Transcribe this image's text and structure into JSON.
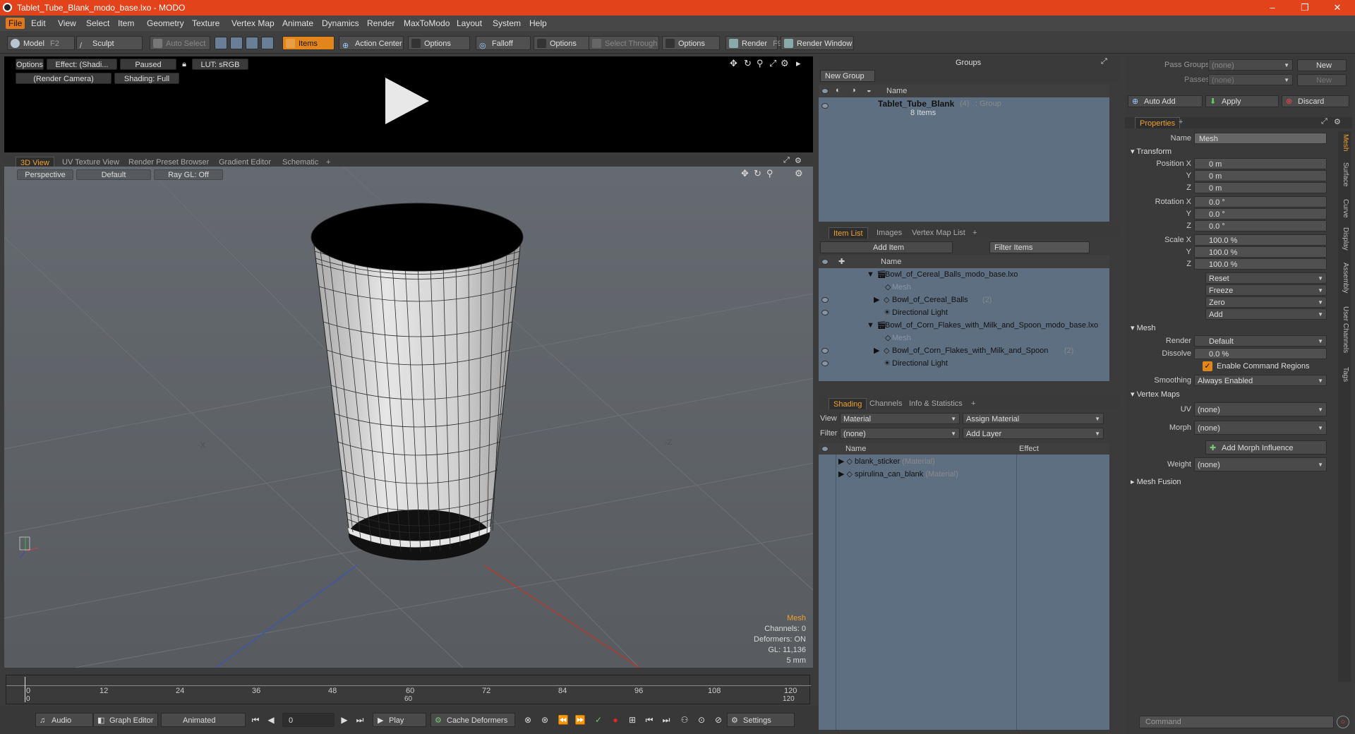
{
  "window": {
    "title": "Tablet_Tube_Blank_modo_base.lxo - MODO"
  },
  "menu": [
    "File",
    "Edit",
    "View",
    "Select",
    "Item",
    "Geometry",
    "Texture",
    "Vertex Map",
    "Animate",
    "Dynamics",
    "Render",
    "MaxToModo",
    "Layout",
    "System",
    "Help"
  ],
  "toolbar": {
    "model": "Model",
    "model_key": "F2",
    "sculpt": "Sculpt",
    "auto_select": "Auto Select",
    "items": "Items",
    "action_center": "Action Center",
    "options1": "Options",
    "falloff": "Falloff",
    "options2": "Options",
    "select_through": "Select Through",
    "options3": "Options",
    "render": "Render",
    "render_key": "F9",
    "render_window": "Render Window"
  },
  "preview": {
    "options": "Options",
    "effect": "Effect: (Shadi...",
    "paused": "Paused",
    "lut": "LUT: sRGB",
    "camera": "(Render Camera)",
    "shading": "Shading: Full"
  },
  "view_tabs": [
    "3D View",
    "UV Texture View",
    "Render Preset Browser",
    "Gradient Editor",
    "Schematic",
    "+"
  ],
  "viewport": {
    "projection": "Perspective",
    "style": "Default",
    "raygl": "Ray GL: Off",
    "axis_x": "-X",
    "axis_z": "-Z",
    "info": {
      "mesh": "Mesh",
      "channels": "Channels: 0",
      "deformers": "Deformers: ON",
      "gl": "GL: 11,136",
      "scale": "5 mm"
    }
  },
  "timeline": {
    "ticks": [
      "0",
      "12",
      "24",
      "36",
      "48",
      "60",
      "72",
      "84",
      "96",
      "108",
      "120"
    ],
    "sub": [
      "0",
      "60",
      "120"
    ]
  },
  "bottombar": {
    "audio": "Audio",
    "graph_editor": "Graph Editor",
    "animated": "Animated",
    "frame": "0",
    "play": "Play",
    "cache": "Cache Deformers",
    "settings": "Settings"
  },
  "groups": {
    "title": "Groups",
    "new_group": "New Group",
    "col_name": "Name",
    "item": {
      "name": "Tablet_Tube_Blank",
      "count": "(4)",
      "type": ": Group",
      "sub": "8 Items"
    }
  },
  "itemlist": {
    "tabs": [
      "Item List",
      "Images",
      "Vertex Map List",
      "+"
    ],
    "add_item": "Add Item",
    "filter": "Filter Items",
    "col_name": "Name",
    "rows": [
      {
        "label": "Bowl_of_Cereal_Balls_modo_base.lxo",
        "suffix": "",
        "indent": 0
      },
      {
        "label": "Mesh",
        "suffix": "",
        "indent": 2
      },
      {
        "label": "Bowl_of_Cereal_Balls",
        "suffix": "(2)",
        "indent": 1
      },
      {
        "label": "Directional Light",
        "suffix": "",
        "indent": 1
      },
      {
        "label": "Bowl_of_Corn_Flakes_with_Milk_and_Spoon_modo_base.lxo",
        "suffix": "",
        "indent": 0
      },
      {
        "label": "Mesh",
        "suffix": "",
        "indent": 2
      },
      {
        "label": "Bowl_of_Corn_Flakes_with_Milk_and_Spoon",
        "suffix": "(2)",
        "indent": 1
      },
      {
        "label": "Directional Light",
        "suffix": "",
        "indent": 1
      }
    ]
  },
  "shading": {
    "tabs": [
      "Shading",
      "Channels",
      "Info & Statistics",
      "+"
    ],
    "view_label": "View",
    "view_value": "Material",
    "assign": "Assign Material",
    "filter_label": "Filter",
    "filter_value": "(none)",
    "add_layer": "Add Layer",
    "col_name": "Name",
    "col_effect": "Effect",
    "rows": [
      {
        "name": "blank_sticker",
        "type": "(Material)"
      },
      {
        "name": "spirulina_can_blank",
        "type": "(Material)"
      }
    ]
  },
  "props": {
    "pass_groups": "Pass Groups",
    "passes": "Passes",
    "none": "(none)",
    "new": "New",
    "auto_add": "Auto Add",
    "apply": "Apply",
    "discard": "Discard",
    "tab": "Properties",
    "name_label": "Name",
    "name_value": "Mesh",
    "transform": "Transform",
    "position": "Position X",
    "rotation": "Rotation X",
    "scale": "Scale X",
    "y": "Y",
    "z": "Z",
    "pos_vals": [
      "0 m",
      "0 m",
      "0 m"
    ],
    "rot_vals": [
      "0.0 °",
      "0.0 °",
      "0.0 °"
    ],
    "scale_vals": [
      "100.0 %",
      "100.0 %",
      "100.0 %"
    ],
    "reset": "Reset",
    "freeze": "Freeze",
    "zero": "Zero",
    "add": "Add",
    "mesh": "Mesh",
    "render_label": "Render",
    "render_value": "Default",
    "dissolve_label": "Dissolve",
    "dissolve_value": "0.0 %",
    "enable_cmd": "Enable Command Regions",
    "smoothing_label": "Smoothing",
    "smoothing_value": "Always Enabled",
    "vertex_maps": "Vertex Maps",
    "uv_label": "UV",
    "morph_label": "Morph",
    "add_morph": "Add Morph Influence",
    "weight_label": "Weight",
    "mesh_fusion": "Mesh Fusion",
    "side_tabs": [
      "Mesh",
      "Surface",
      "Curve",
      "Display",
      "Assembly",
      "User Channels",
      "Tags"
    ],
    "command": "Command"
  }
}
